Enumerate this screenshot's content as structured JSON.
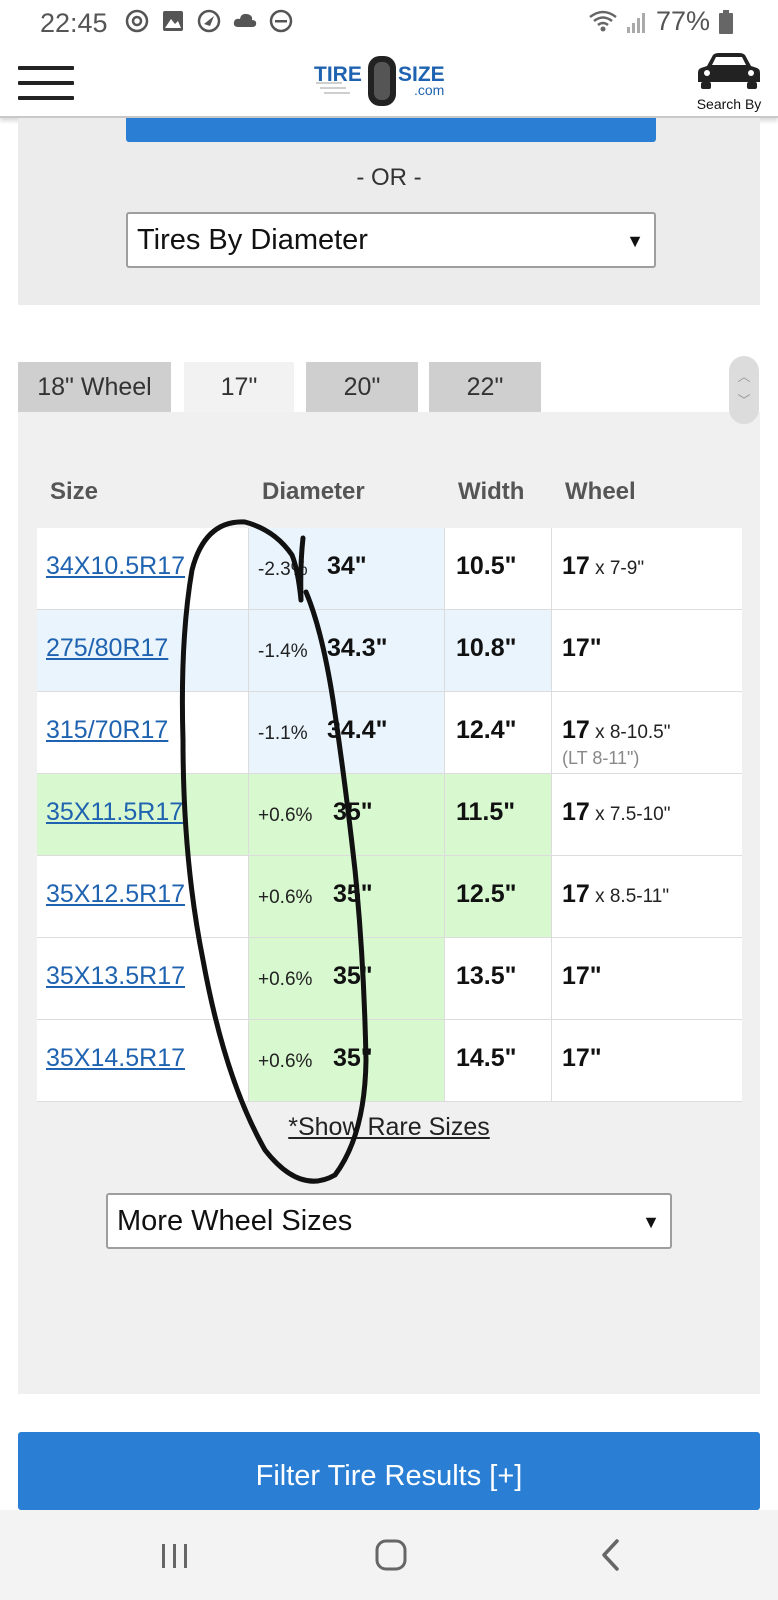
{
  "status_bar": {
    "time": "22:45",
    "battery": "77%",
    "left_icons": [
      "threads-icon",
      "gallery-icon",
      "app-icon",
      "cloud-icon",
      "do-not-disturb-icon"
    ],
    "right_icons": [
      "wifi-icon",
      "signal-icon",
      "battery-icon"
    ]
  },
  "header": {
    "logo_text_left": "TIRE",
    "logo_text_right": "SIZE",
    "logo_text_domain": ".com",
    "search_by_label": "Search By"
  },
  "top_panel": {
    "or_text": "- OR -",
    "diameter_select": "Tires By Diameter"
  },
  "tabs": [
    {
      "label": "18\" Wheel",
      "active": false
    },
    {
      "label": "17\"",
      "active": true
    },
    {
      "label": "20\"",
      "active": false
    },
    {
      "label": "22\"",
      "active": false
    }
  ],
  "table": {
    "headers": {
      "size": "Size",
      "diameter": "Diameter",
      "width": "Width",
      "wheel": "Wheel"
    },
    "rows": [
      {
        "size": "34X10.5R17",
        "pct": "-2.3%",
        "diameter": "34\"",
        "width": "10.5\"",
        "wheel": "17",
        "wheel_range": " x 7-9\"",
        "wheel_sub": ""
      },
      {
        "size": "275/80R17",
        "pct": "-1.4%",
        "diameter": "34.3\"",
        "width": "10.8\"",
        "wheel": "17\"",
        "wheel_range": "",
        "wheel_sub": ""
      },
      {
        "size": "315/70R17",
        "pct": "-1.1%",
        "diameter": "34.4\"",
        "width": "12.4\"",
        "wheel": "17",
        "wheel_range": " x 8-10.5\"",
        "wheel_sub": "(LT 8-11\")"
      },
      {
        "size": "35X11.5R17",
        "pct": "+0.6%",
        "diameter": "35\"",
        "width": "11.5\"",
        "wheel": "17",
        "wheel_range": " x 7.5-10\"",
        "wheel_sub": ""
      },
      {
        "size": "35X12.5R17",
        "pct": "+0.6%",
        "diameter": "35\"",
        "width": "12.5\"",
        "wheel": "17",
        "wheel_range": " x 8.5-11\"",
        "wheel_sub": ""
      },
      {
        "size": "35X13.5R17",
        "pct": "+0.6%",
        "diameter": "35\"",
        "width": "13.5\"",
        "wheel": "17\"",
        "wheel_range": "",
        "wheel_sub": ""
      },
      {
        "size": "35X14.5R17",
        "pct": "+0.6%",
        "diameter": "35\"",
        "width": "14.5\"",
        "wheel": "17\"",
        "wheel_range": "",
        "wheel_sub": ""
      }
    ]
  },
  "show_rare_label": "*Show Rare Sizes",
  "wheel_select": "More Wheel Sizes",
  "filter_button": "Filter Tire Results [+]",
  "colors": {
    "brand_blue": "#2a7fd4",
    "link_blue": "#1f63b0",
    "highlight_blue": "#e9f4fd",
    "highlight_green": "#d8f8cf"
  }
}
